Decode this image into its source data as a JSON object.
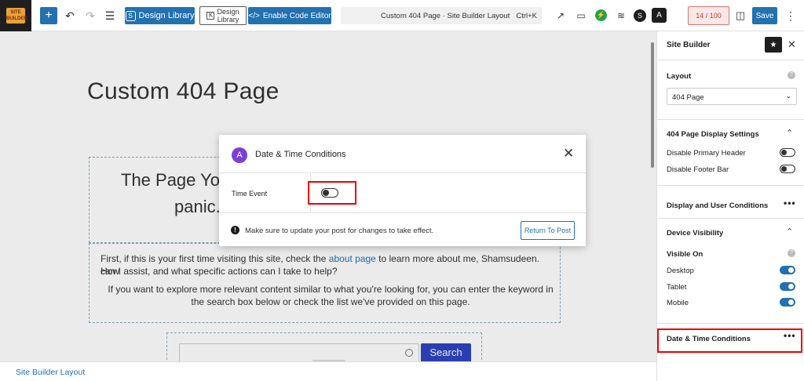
{
  "toolbar": {
    "logo_text": "SITE BUILDER",
    "add_symbol": "+",
    "undo_icon": "↶",
    "redo_icon": "↷",
    "list_icon": "☰",
    "design_library_label": "Design Library",
    "design_library2_label_line1": "Design",
    "design_library2_label_line2": "Library",
    "code_editor_label": "Enable Code Editor",
    "command_title": "Custom 404 Page · Site Builder Layout",
    "command_shortcut": "Ctrl+K",
    "score": "14 / 100",
    "save_label": "Save",
    "more_icon": "⋮"
  },
  "canvas": {
    "page_title": "Custom 404 Page",
    "heading_line1": "The Page You",
    "heading_line2": "panic.",
    "para1_a": "First, if this is your first time visiting this site, check the",
    "para1_link": "about page",
    "para1_b": "to learn more about me, Shamsudeen. How",
    "para1_c": "can I assist, and what specific actions can I take to help?",
    "para2_a": "If you want to explore more relevant content similar to what you're looking for, you can enter the keyword in the",
    "para2_b": "search box below or check the list we've provided on this page.",
    "search_button": "Search"
  },
  "bottom_bar": {
    "label": "Site Builder Layout"
  },
  "modal": {
    "title": "Date & Time Conditions",
    "logo_letter": "A",
    "close_symbol": "✕",
    "field_label": "Time Event",
    "toggle_on": false,
    "warning_symbol": "!",
    "message": "Make sure to update your post for changes to take effect.",
    "return_button": "Return To Post"
  },
  "sidebar": {
    "title": "Site Builder",
    "close_symbol": "✕",
    "layout_label": "Layout",
    "layout_value": "404 Page",
    "display_settings_title": "404 Page Display Settings",
    "disable_header": "Disable Primary Header",
    "disable_footer": "Disable Footer Bar",
    "display_user_conditions": "Display and User Conditions",
    "device_visibility": "Device Visibility",
    "visible_on": "Visible On",
    "devices": [
      {
        "label": "Desktop",
        "on": true
      },
      {
        "label": "Tablet",
        "on": true
      },
      {
        "label": "Mobile",
        "on": true
      }
    ],
    "date_time_conditions": "Date & Time Conditions",
    "more_symbol": "•••"
  },
  "colors": {
    "accent": "#2271b1",
    "highlight": "#e00000",
    "modal_logo": "#7b3fd4"
  }
}
